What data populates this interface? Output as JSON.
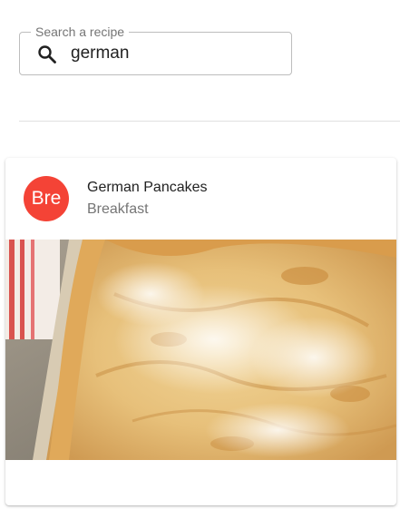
{
  "search": {
    "label": "Search a recipe",
    "value": "german",
    "icon": "search-icon"
  },
  "recipe_card": {
    "avatar_text": "Bre",
    "avatar_color": "#f44336",
    "title": "German Pancakes",
    "category": "Breakfast",
    "image_description": "photo"
  },
  "colors": {
    "avatar": "#f44336",
    "border": "#bdbdbd",
    "divider": "#e0e0e0"
  }
}
